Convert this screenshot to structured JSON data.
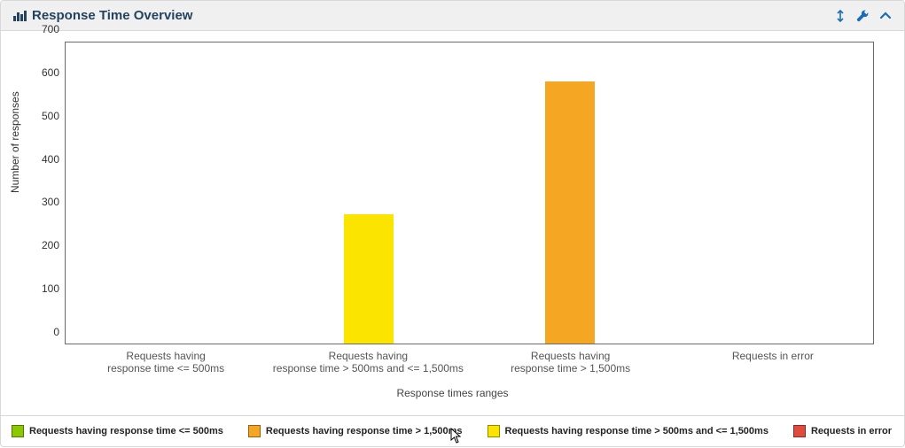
{
  "panel": {
    "title": "Response Time Overview",
    "icon": "bar-chart-icon",
    "actions": {
      "move": "move-icon",
      "settings": "wrench-icon",
      "collapse": "chevron-up-icon"
    }
  },
  "chart_data": {
    "type": "bar",
    "title": "",
    "xlabel": "Response times ranges",
    "ylabel": "Number of responses",
    "ylim": [
      0,
      700
    ],
    "yticks": [
      0,
      100,
      200,
      300,
      400,
      500,
      600,
      700
    ],
    "categories_lines": [
      [
        "Requests having",
        "response time <= 500ms"
      ],
      [
        "Requests having",
        "response time > 500ms and <= 1,500ms"
      ],
      [
        "Requests having",
        "response time > 1,500ms"
      ],
      [
        "Requests in error",
        ""
      ]
    ],
    "values": [
      0,
      300,
      610,
      0
    ],
    "colors": [
      "#8ac800",
      "#fbe400",
      "#f5a623",
      "#e04a3f"
    ]
  },
  "legend": [
    {
      "label": "Requests having response time <= 500ms",
      "color": "#8ac800"
    },
    {
      "label": "Requests having response time > 1,500ms",
      "color": "#f5a623"
    },
    {
      "label": "Requests having response time > 500ms and <= 1,500ms",
      "color": "#fbe400"
    },
    {
      "label": "Requests in error",
      "color": "#e04a3f"
    }
  ],
  "cursor_over_legend_index": 1
}
